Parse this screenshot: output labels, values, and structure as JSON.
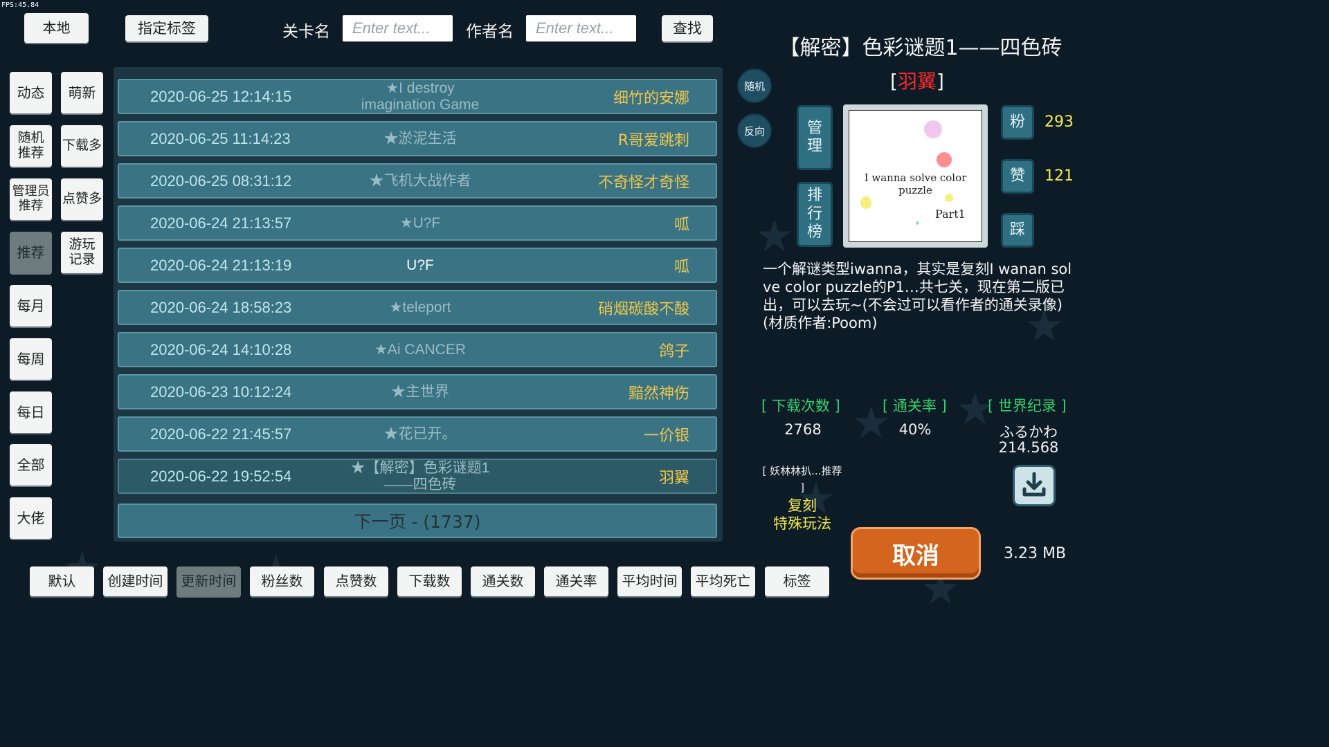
{
  "fps": "FPS:45.84",
  "top": {
    "local_label": "本地",
    "tag_label": "指定标签",
    "level_name_label": "关卡名",
    "level_placeholder": "Enter text...",
    "author_label": "作者名",
    "author_placeholder": "Enter text...",
    "search_label": "查找"
  },
  "sidebar": {
    "items": [
      {
        "label": "动态"
      },
      {
        "label": "萌新"
      },
      {
        "label": "随机\n推荐"
      },
      {
        "label": "下载多"
      },
      {
        "label": "管理员\n推荐"
      },
      {
        "label": "点赞多"
      },
      {
        "label": "推荐"
      },
      {
        "label": "游玩\n记录"
      },
      {
        "label": "每月"
      },
      {
        "label": "每周"
      },
      {
        "label": "每日"
      },
      {
        "label": "全部"
      },
      {
        "label": "大佬"
      }
    ]
  },
  "list": {
    "rows": [
      {
        "date": "2020-06-25 12:14:15",
        "title": "★I destroy imagination Game",
        "author": "细竹的安娜"
      },
      {
        "date": "2020-06-25 11:14:23",
        "title": "★淤泥生活",
        "author": "R哥爱跳刺"
      },
      {
        "date": "2020-06-25 08:31:12",
        "title": "★飞机大战作者",
        "author": "不奇怪才奇怪"
      },
      {
        "date": "2020-06-24 21:13:57",
        "title": "★U?F",
        "author": "呱"
      },
      {
        "date": "2020-06-24 21:13:19",
        "title": "U?F",
        "author": "呱"
      },
      {
        "date": "2020-06-24 18:58:23",
        "title": "★teleport",
        "author": "硝烟碳酸不酸"
      },
      {
        "date": "2020-06-24 14:10:28",
        "title": "★Ai CANCER",
        "author": "鸽子"
      },
      {
        "date": "2020-06-23 10:12:24",
        "title": "★主世界",
        "author": "黯然神伤"
      },
      {
        "date": "2020-06-22 21:45:57",
        "title": "★花已开。",
        "author": "一价银"
      },
      {
        "date": "2020-06-22 19:52:54",
        "title": "★【解密】色彩谜题1——四色砖",
        "author": "羽翼"
      }
    ],
    "next_page": "下一页 - (1737)"
  },
  "side_buttons": {
    "random": "随机",
    "reverse": "反向",
    "manage": "管\n理",
    "ranking": "排\n行\n榜"
  },
  "detail": {
    "title": "【解密】色彩谜题1——四色砖",
    "author_open": "[",
    "author": "羽翼",
    "author_close": "]",
    "thumb_text": "I wanna solve color puzzle",
    "thumb_sub": "Part1",
    "fans_label": "粉",
    "fans_count": "293",
    "likes_label": "赞",
    "likes_count": "121",
    "dislike_label": "踩",
    "description": "一个解谜类型iwanna，其实是复刻I wanan solve color puzzle的P1…共七关，现在第二版已出，可以去玩~(不会过可以看作者的通关录像)(材质作者:Poom)",
    "downloads_header": "[ 下载次数 ]",
    "downloads_value": "2768",
    "clear_rate_header": "[ 通关率 ]",
    "clear_rate_value": "40%",
    "record_header": "[ 世界纪录 ]",
    "record_holder": "ふるかわ",
    "record_time": "214.568",
    "recommender": "[ 妖林林扒...推荐\n]",
    "tag_1": "复刻",
    "tag_2": "特殊玩法",
    "cancel_label": "取消",
    "file_size": "3.23 MB"
  },
  "sort": {
    "items": [
      {
        "label": "默认"
      },
      {
        "label": "创建时间"
      },
      {
        "label": "更新时间"
      },
      {
        "label": "粉丝数"
      },
      {
        "label": "点赞数"
      },
      {
        "label": "下载数"
      },
      {
        "label": "通关数"
      },
      {
        "label": "通关率"
      },
      {
        "label": "平均时间"
      },
      {
        "label": "平均死亡"
      },
      {
        "label": "标签"
      }
    ]
  },
  "colors": {
    "background": "#0d1b26",
    "row": "#3a7484",
    "author_gold": "#f0c54a",
    "stat_yellow": "#f4e94d",
    "header_green": "#31d36b",
    "author_red": "#ff2a2a",
    "cancel_orange": "#d4651f"
  }
}
